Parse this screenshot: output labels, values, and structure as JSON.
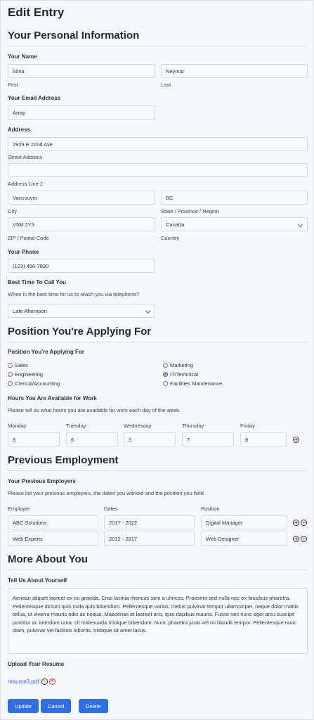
{
  "title": "Edit Entry",
  "personal": {
    "heading": "Your Personal Information",
    "name_label": "Your Name",
    "first_value": "Alina",
    "first_sub": "First",
    "last_value": "Neymar",
    "last_sub": "Last",
    "email_label": "Your Email Address",
    "email_value": "Array",
    "address_label": "Address",
    "street_value": "2929 E 22nd Ave",
    "street_sub": "Street Address",
    "line2_value": "",
    "line2_sub": "Address Line 2",
    "city_value": "Vancouver",
    "city_sub": "City",
    "state_value": "BC",
    "state_sub": "State / Province / Region",
    "zip_value": "V5M 2Y3",
    "zip_sub": "ZIP / Postal Code",
    "country_value": "Canada",
    "country_sub": "Country",
    "phone_label": "Your Phone",
    "phone_value": "(123) 456-7890",
    "time_label": "Best Time To Call You",
    "time_desc": "When is the best time for us to reach you via telephone?",
    "time_value": "Late Afternoon"
  },
  "position": {
    "heading": "Position You're Applying For",
    "label": "Position You're Applying For",
    "options": [
      "Sales",
      "Marketing",
      "Engineering",
      "IT/Technical",
      "Clerical/Accounting",
      "Facilities Maintenance"
    ],
    "selected": "IT/Technical",
    "hours_label": "Hours You Are Available for Work",
    "hours_desc": "Please tell us what hours you are available for work each day of the week.",
    "days": [
      "Monday",
      "Tuesday",
      "Wednesday",
      "Thursday",
      "Friday"
    ],
    "hours": [
      "8",
      "6",
      "3",
      "7",
      "8"
    ]
  },
  "employment": {
    "heading": "Previous Employment",
    "label": "Your Previous Employers",
    "desc": "Please list your previous employers, the dates you worked and the position you held",
    "cols": [
      "Employer",
      "Dates",
      "Position"
    ],
    "rows": [
      [
        "ABC Solutions",
        "2017 - 2022",
        "Digital Manager"
      ],
      [
        "Web Experts",
        "2012 - 2017",
        "Web Designer"
      ]
    ]
  },
  "about": {
    "heading": "More About You",
    "tell_label": "Tell Us About Yourself",
    "tell_value": "Aenean aliquet laoreet ex eu gravida. Cras lacinia rhoncus sem a ultrices. Praesent sed nulla nec ex faucibus pharetra. Pellentesque dictum quis nulla quis bibendum. Pellentesque varius, metus pulvinar tempor ullamcorper, neque dolor mattis tellus, ut viverra mauris odio ac neque. Maecenas et laoreet orci, quis dapibus mauris. Fusce nec nunc eget arcu suscipit porttitor ac interdum urna. Ut malesuada tristique bibendum. Nunc pharetra justo vel mi blandit tempor. Pellentesque nunc diam, pulvinar vel facilisis lobortis, tristique sit amet lacus.",
    "resume_label": "Upload Your Resume",
    "resume_file": "resume3.pdf"
  },
  "buttons": {
    "update": "Update",
    "cancel": "Cancel",
    "delete": "Delete"
  },
  "colors": {
    "accent": "#2f6fe4",
    "remove": "#e53e3e"
  }
}
